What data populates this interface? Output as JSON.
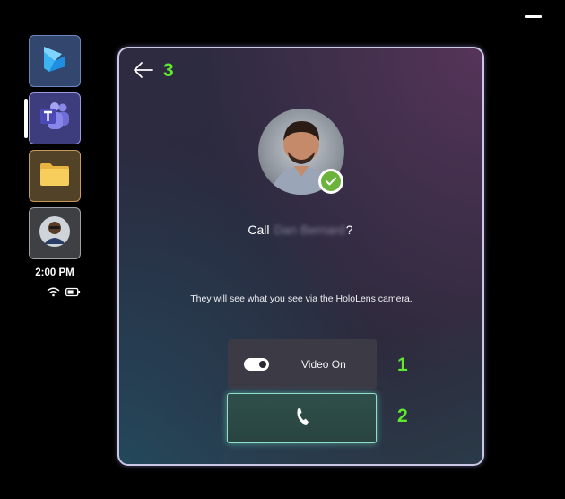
{
  "window": {
    "back_label": "Back",
    "title_prefix": "Call",
    "contact_name": "Dan Bernard",
    "title_suffix": "?",
    "info_text": "They will see what you see via the HoloLens camera."
  },
  "video_toggle": {
    "label": "Video On",
    "state": "on"
  },
  "taskbar": {
    "apps": [
      {
        "name": "Dynamics 365 Guides",
        "icon": "dynamics-icon"
      },
      {
        "name": "Microsoft Teams",
        "icon": "teams-icon",
        "active": true
      },
      {
        "name": "File Explorer",
        "icon": "folder-icon"
      },
      {
        "name": "Contact photo",
        "icon": "person-icon"
      }
    ],
    "time": "2:00 PM"
  },
  "callouts": [
    "1",
    "2",
    "3"
  ],
  "colors": {
    "accent_green": "#5ee82e",
    "call_button_border": "#8fe0c8",
    "presence_available": "#6bb33a"
  }
}
